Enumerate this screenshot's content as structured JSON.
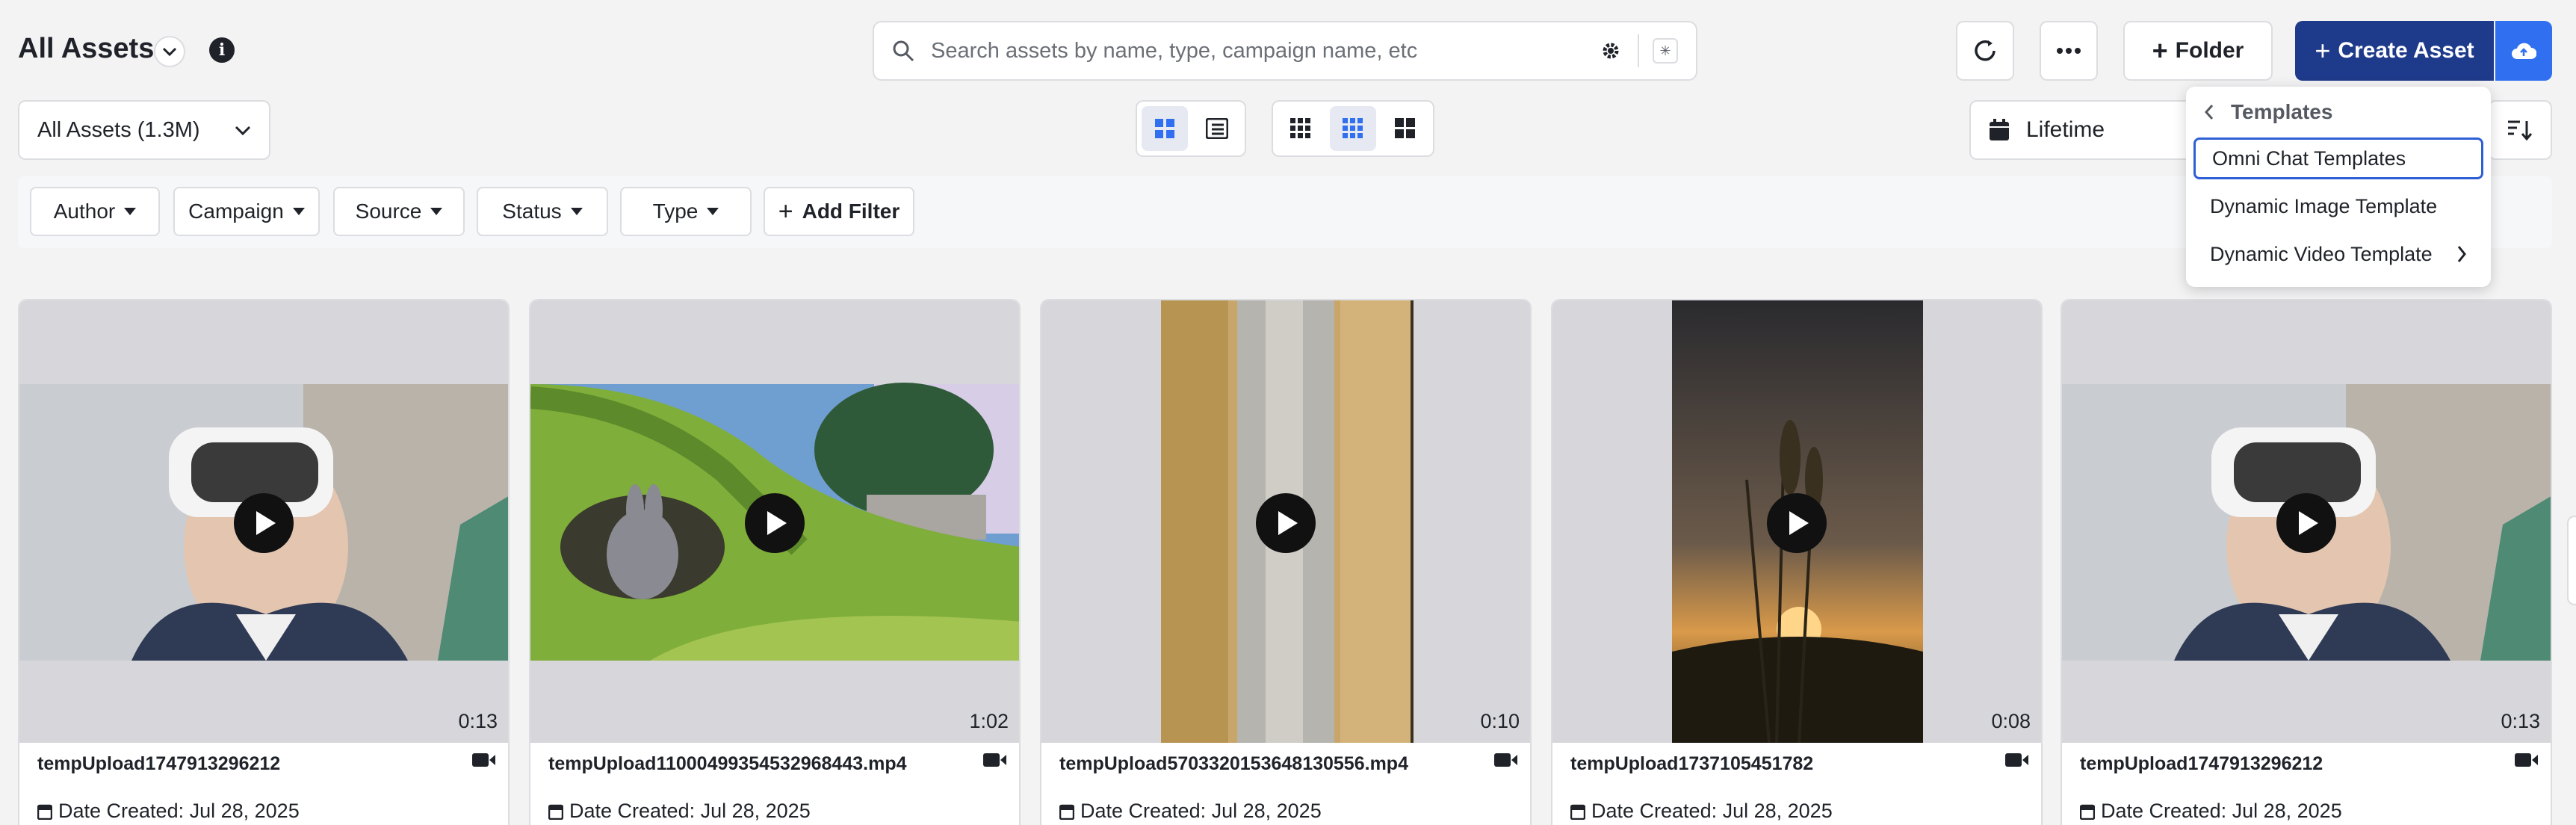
{
  "header": {
    "title": "All Assets",
    "search_placeholder": "Search assets by name, type, campaign name, etc",
    "folder_label": "Folder",
    "create_label": "Create Asset"
  },
  "toolbar": {
    "assets_dropdown": "All Assets (1.3M)",
    "date_range": "Lifetime"
  },
  "filters": [
    "Author",
    "Campaign",
    "Source",
    "Status",
    "Type"
  ],
  "add_filter_label": "Add Filter",
  "dropdown": {
    "header": "Templates",
    "items": [
      "Omni Chat Templates",
      "Dynamic Image Template",
      "Dynamic Video Template"
    ]
  },
  "cards": [
    {
      "name": "tempUpload1747913296212",
      "duration": "0:13",
      "date": "Date Created: Jul 28, 2025",
      "type_icon": "video-icon"
    },
    {
      "name": "tempUpload11000499354532968443.mp4",
      "duration": "1:02",
      "date": "Date Created: Jul 28, 2025",
      "type_icon": "video-icon"
    },
    {
      "name": "tempUpload5703320153648130556.mp4",
      "duration": "0:10",
      "date": "Date Created: Jul 28, 2025",
      "type_icon": "video-icon"
    },
    {
      "name": "tempUpload1737105451782",
      "duration": "0:08",
      "date": "Date Created: Jul 28, 2025",
      "type_icon": "video-icon"
    },
    {
      "name": "tempUpload1747913296212",
      "duration": "0:13",
      "date": "Date Created: Jul 28, 2025",
      "type_icon": "video-icon"
    }
  ],
  "colors": {
    "primary": "#1e3a8a",
    "accent": "#2f6ff0",
    "border": "#dcdde0",
    "background": "#f3f3f4"
  }
}
